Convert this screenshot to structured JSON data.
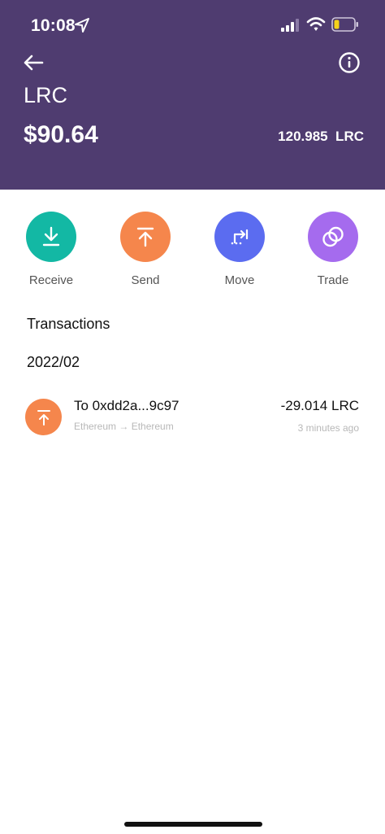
{
  "status_bar": {
    "time": "10:08"
  },
  "header": {
    "symbol": "LRC",
    "fiat_balance": "$90.64",
    "token_balance": "120.985  LRC",
    "background_color": "#4f3c70"
  },
  "actions": [
    {
      "label": "Receive",
      "color": "#13b8a4",
      "icon": "download-icon"
    },
    {
      "label": "Send",
      "color": "#f5864c",
      "icon": "upload-icon"
    },
    {
      "label": "Move",
      "color": "#5b6cf0",
      "icon": "move-icon"
    },
    {
      "label": "Trade",
      "color": "#a56bee",
      "icon": "trade-icon"
    }
  ],
  "transactions": {
    "title": "Transactions",
    "groups": [
      {
        "month": "2022/02",
        "items": [
          {
            "title": "To 0xdd2a...9c97",
            "route": "Ethereum → Ethereum",
            "amount": "-29.014 LRC",
            "time": "3 minutes ago",
            "icon": "send-icon",
            "color": "#f5864c"
          }
        ]
      }
    ]
  }
}
